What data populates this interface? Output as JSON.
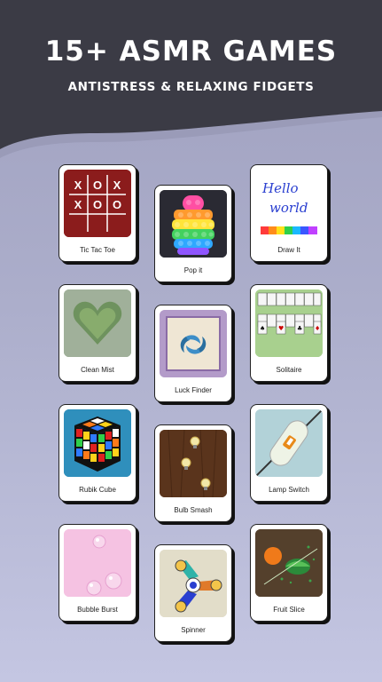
{
  "header": {
    "title": "15+ ASMR GAMES",
    "subtitle": "ANTISTRESS & RELAXING FIDGETS"
  },
  "games": [
    {
      "label": "Tic Tac Toe",
      "icon": "tic-tac-toe-thumbnail"
    },
    {
      "label": "Pop it",
      "icon": "pop-it-thumbnail"
    },
    {
      "label": "Draw It",
      "icon": "draw-it-thumbnail"
    },
    {
      "label": "Clean Mist",
      "icon": "clean-mist-thumbnail"
    },
    {
      "label": "Luck Finder",
      "icon": "luck-finder-thumbnail"
    },
    {
      "label": "Solitaire",
      "icon": "solitaire-thumbnail"
    },
    {
      "label": "Rubik Cube",
      "icon": "rubik-cube-thumbnail"
    },
    {
      "label": "Bulb Smash",
      "icon": "bulb-smash-thumbnail"
    },
    {
      "label": "Lamp Switch",
      "icon": "lamp-switch-thumbnail"
    },
    {
      "label": "Bubble Burst",
      "icon": "bubble-burst-thumbnail"
    },
    {
      "label": "Spinner",
      "icon": "spinner-thumbnail"
    },
    {
      "label": "Fruit Slice",
      "icon": "fruit-slice-thumbnail"
    }
  ],
  "tic_tac_toe_cells": [
    "X",
    "O",
    "X",
    "X",
    "O",
    "O",
    "",
    "",
    ""
  ],
  "draw_it_text": [
    "Hello",
    "world"
  ],
  "colors": {
    "header_dark": "#3b3b45",
    "background_top": "#9fa0bf",
    "background_bottom": "#c4c6e2",
    "tic_tac_toe_red": "#8b1c1c"
  }
}
